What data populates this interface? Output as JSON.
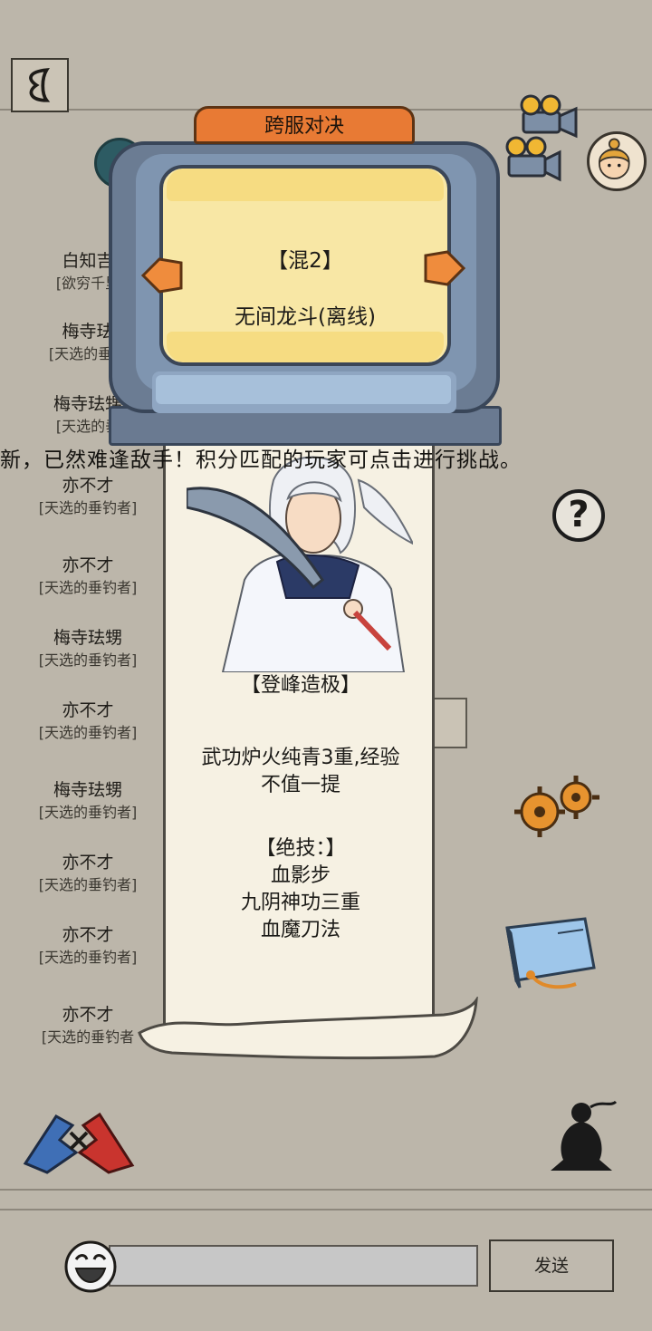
{
  "header": {
    "back_icon": "back-arrow-icon",
    "title_tab": "跨服对决"
  },
  "screen": {
    "server": "【混2】",
    "mode": "无间龙斗(离线)"
  },
  "marquee": "新，已然难逢敌手！积分匹配的玩家可点击进行挑战。",
  "ranking_list": [
    {
      "name": "白知吉",
      "title": "[欲穷千里"
    },
    {
      "name": "梅寺珐",
      "title": "[天选的垂钓"
    },
    {
      "name": "梅寺珐甥",
      "title": "[天选的垂"
    },
    {
      "name": "亦不才",
      "title": "[天选的垂钓者]"
    },
    {
      "name": "亦不才",
      "title": "[天选的垂钓者]"
    },
    {
      "name": "梅寺珐甥",
      "title": "[天选的垂钓者]"
    },
    {
      "name": "亦不才",
      "title": "[天选的垂钓者]"
    },
    {
      "name": "梅寺珐甥",
      "title": "[天选的垂钓者]"
    },
    {
      "name": "亦不才",
      "title": "[天选的垂钓者]"
    },
    {
      "name": "亦不才",
      "title": "[天选的垂钓者]"
    },
    {
      "name": "亦不才",
      "title": "[天选的垂钓者"
    }
  ],
  "scroll": {
    "rank": "【登峰造极】",
    "desc_line1": "武功炉火纯青3重,经验",
    "desc_line2": "不值一提",
    "skills_header": "【绝技：】",
    "skills": [
      "血影步",
      "九阴神功三重",
      "血魔刀法"
    ]
  },
  "chat": {
    "input_value": "",
    "send_label": "发送"
  },
  "icons": {
    "help": "?",
    "camera": "camera-icon",
    "avatar": "avatar-icon",
    "settings": "gear-icon",
    "book": "book-icon",
    "fight": "fight-icon",
    "meditate": "meditate-icon",
    "emoji": "emoji-icon"
  },
  "colors": {
    "background": "#bcb6aa",
    "tab_orange": "#e87a34",
    "screen_yellow": "#f8e7a5",
    "tv_blue": "#6b7c93"
  }
}
